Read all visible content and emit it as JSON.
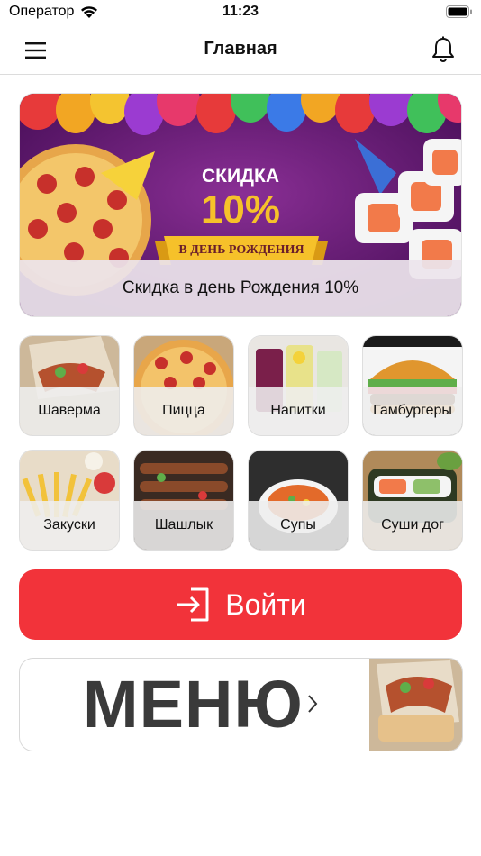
{
  "status_bar": {
    "carrier": "Оператор",
    "time": "11:23"
  },
  "nav": {
    "title": "Главная",
    "menu_icon": "hamburger-menu-icon",
    "bell_icon": "bell-icon"
  },
  "banner": {
    "headline": "СКИДКА",
    "percent": "10%",
    "ribbon": "В ДЕНЬ РОЖДЕНИЯ",
    "caption": "Скидка в день Рождения 10%"
  },
  "categories": [
    {
      "label": "Шаверма"
    },
    {
      "label": "Пицца"
    },
    {
      "label": "Напитки"
    },
    {
      "label": "Гамбургеры"
    },
    {
      "label": "Закуски"
    },
    {
      "label": "Шашлык"
    },
    {
      "label": "Супы"
    },
    {
      "label": "Суши дог"
    }
  ],
  "login": {
    "label": "Войти",
    "icon": "sign-in-icon"
  },
  "menu_card": {
    "label": "МЕНЮ",
    "chevron": "chevron-right-icon"
  },
  "colors": {
    "accent": "#f2333a",
    "banner_purple": "#6a1f7a",
    "text": "#111111"
  }
}
